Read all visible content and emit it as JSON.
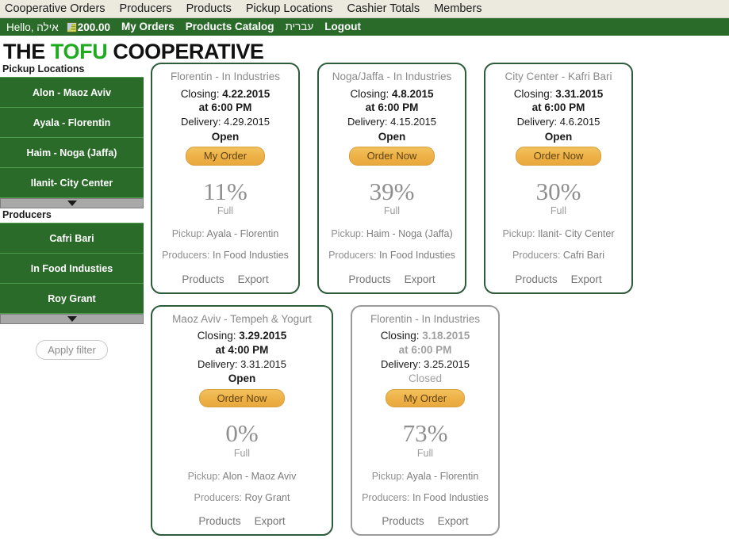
{
  "topmenu": {
    "items": [
      {
        "label": "Cooperative Orders"
      },
      {
        "label": "Producers"
      },
      {
        "label": "Products"
      },
      {
        "label": "Pickup Locations"
      },
      {
        "label": "Cashier Totals"
      },
      {
        "label": "Members"
      }
    ]
  },
  "greenbar": {
    "greeting": "Hello, אילה",
    "money_icon": "banknote-icon",
    "balance": "200.00",
    "my_orders": "My Orders",
    "products_catalog": "Products Catalog",
    "hebrew": "עברית",
    "logout": "Logout"
  },
  "logo": {
    "part1": "THE ",
    "highlight": "TOFU",
    "part2": " COOPERATIVE",
    "highlight_color": "#1faa1f"
  },
  "sidebar": {
    "pickup_locations_label": "Pickup Locations",
    "pickup_locations": [
      {
        "label": "Alon - Maoz Aviv"
      },
      {
        "label": "Ayala - Florentin"
      },
      {
        "label": "Haim - Noga (Jaffa)"
      },
      {
        "label": "Ilanit- City Center"
      }
    ],
    "producers_label": "Producers",
    "producers": [
      {
        "label": "Cafri Bari"
      },
      {
        "label": "In Food Industies"
      },
      {
        "label": "Roy Grant"
      }
    ],
    "scroll_icon": "chevron-down-icon",
    "apply_filter": "Apply filter"
  },
  "labels": {
    "closing": "Closing:",
    "delivery": "Delivery:",
    "full": "Full",
    "pickup": "Pickup:",
    "producers": "Producers:",
    "products_link": "Products",
    "export_link": "Export"
  },
  "cards": [
    {
      "title": "Florentin - In Industries",
      "closing_date": "4.22.2015",
      "closing_time": "at 6:00 PM",
      "delivery_date": "4.29.2015",
      "status": "Open",
      "button": "My Order",
      "percent": "11%",
      "pickup": "Ayala - Florentin",
      "producers": "In Food Industies",
      "closed": false,
      "wide": false
    },
    {
      "title": "Noga/Jaffa - In Industries",
      "closing_date": "4.8.2015",
      "closing_time": "at 6:00 PM",
      "delivery_date": "4.15.2015",
      "status": "Open",
      "button": "Order Now",
      "percent": "39%",
      "pickup": "Haim - Noga (Jaffa)",
      "producers": "In Food Industies",
      "closed": false,
      "wide": false
    },
    {
      "title": "City Center - Kafri Bari",
      "closing_date": "3.31.2015",
      "closing_time": "at 6:00 PM",
      "delivery_date": "4.6.2015",
      "status": "Open",
      "button": "Order Now",
      "percent": "30%",
      "pickup": "Ilanit- City Center",
      "producers": "Cafri Bari",
      "closed": false,
      "wide": false
    },
    {
      "title": "Maoz Aviv - Tempeh & Yogurt",
      "closing_date": "3.29.2015",
      "closing_time": "at 4:00 PM",
      "delivery_date": "3.31.2015",
      "status": "Open",
      "button": "Order Now",
      "percent": "0%",
      "pickup": "Alon - Maoz Aviv",
      "producers": "Roy Grant",
      "closed": false,
      "wide": true
    },
    {
      "title": "Florentin - In Industries",
      "closing_date": "3.18.2015",
      "closing_time": "at 6:00 PM",
      "delivery_date": "3.25.2015",
      "status": "Closed",
      "button": "My Order",
      "percent": "73%",
      "pickup": "Ayala - Florentin",
      "producers": "In Food Industies",
      "closed": true,
      "wide": false
    }
  ],
  "colors": {
    "brand_green": "#2a6b2a",
    "card_border": "#2d5c3a",
    "card_border_closed": "#9a9a9a",
    "button_orange": "#eeb248",
    "topbar_bg": "#eceadf"
  }
}
